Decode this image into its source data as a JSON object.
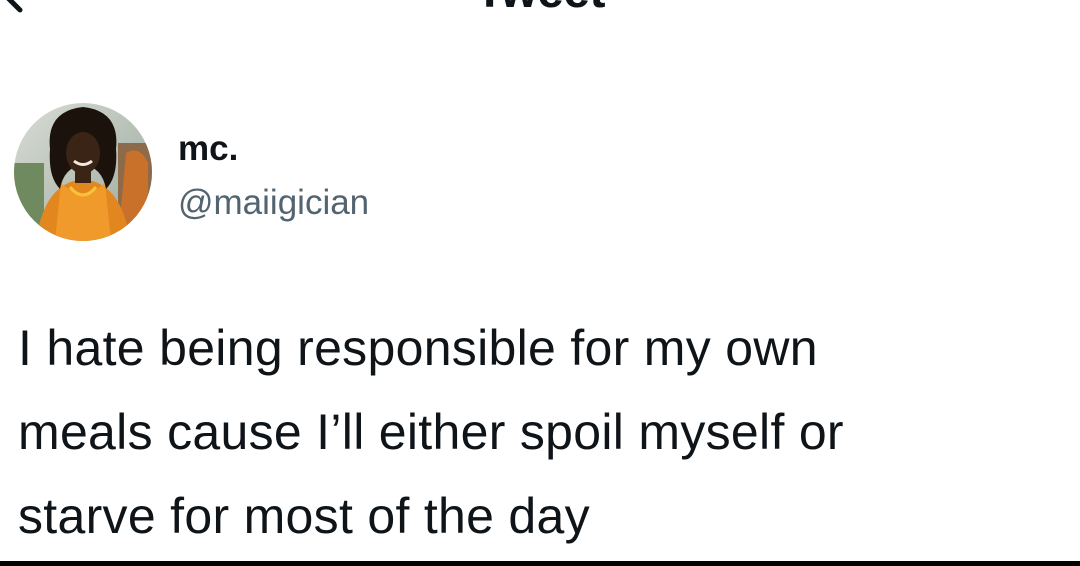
{
  "header": {
    "title": "Tweet",
    "back_icon": "arrow-left-icon"
  },
  "author": {
    "display_name": "mc.",
    "handle": "@maiigician",
    "avatar": "profile-photo"
  },
  "tweet": {
    "lines": [
      "I hate being responsible for my own",
      "meals cause I’ll either spoil myself or",
      "starve for most of the day"
    ]
  },
  "colors": {
    "text": "#0f1419",
    "handle": "#536471",
    "background": "#ffffff"
  }
}
